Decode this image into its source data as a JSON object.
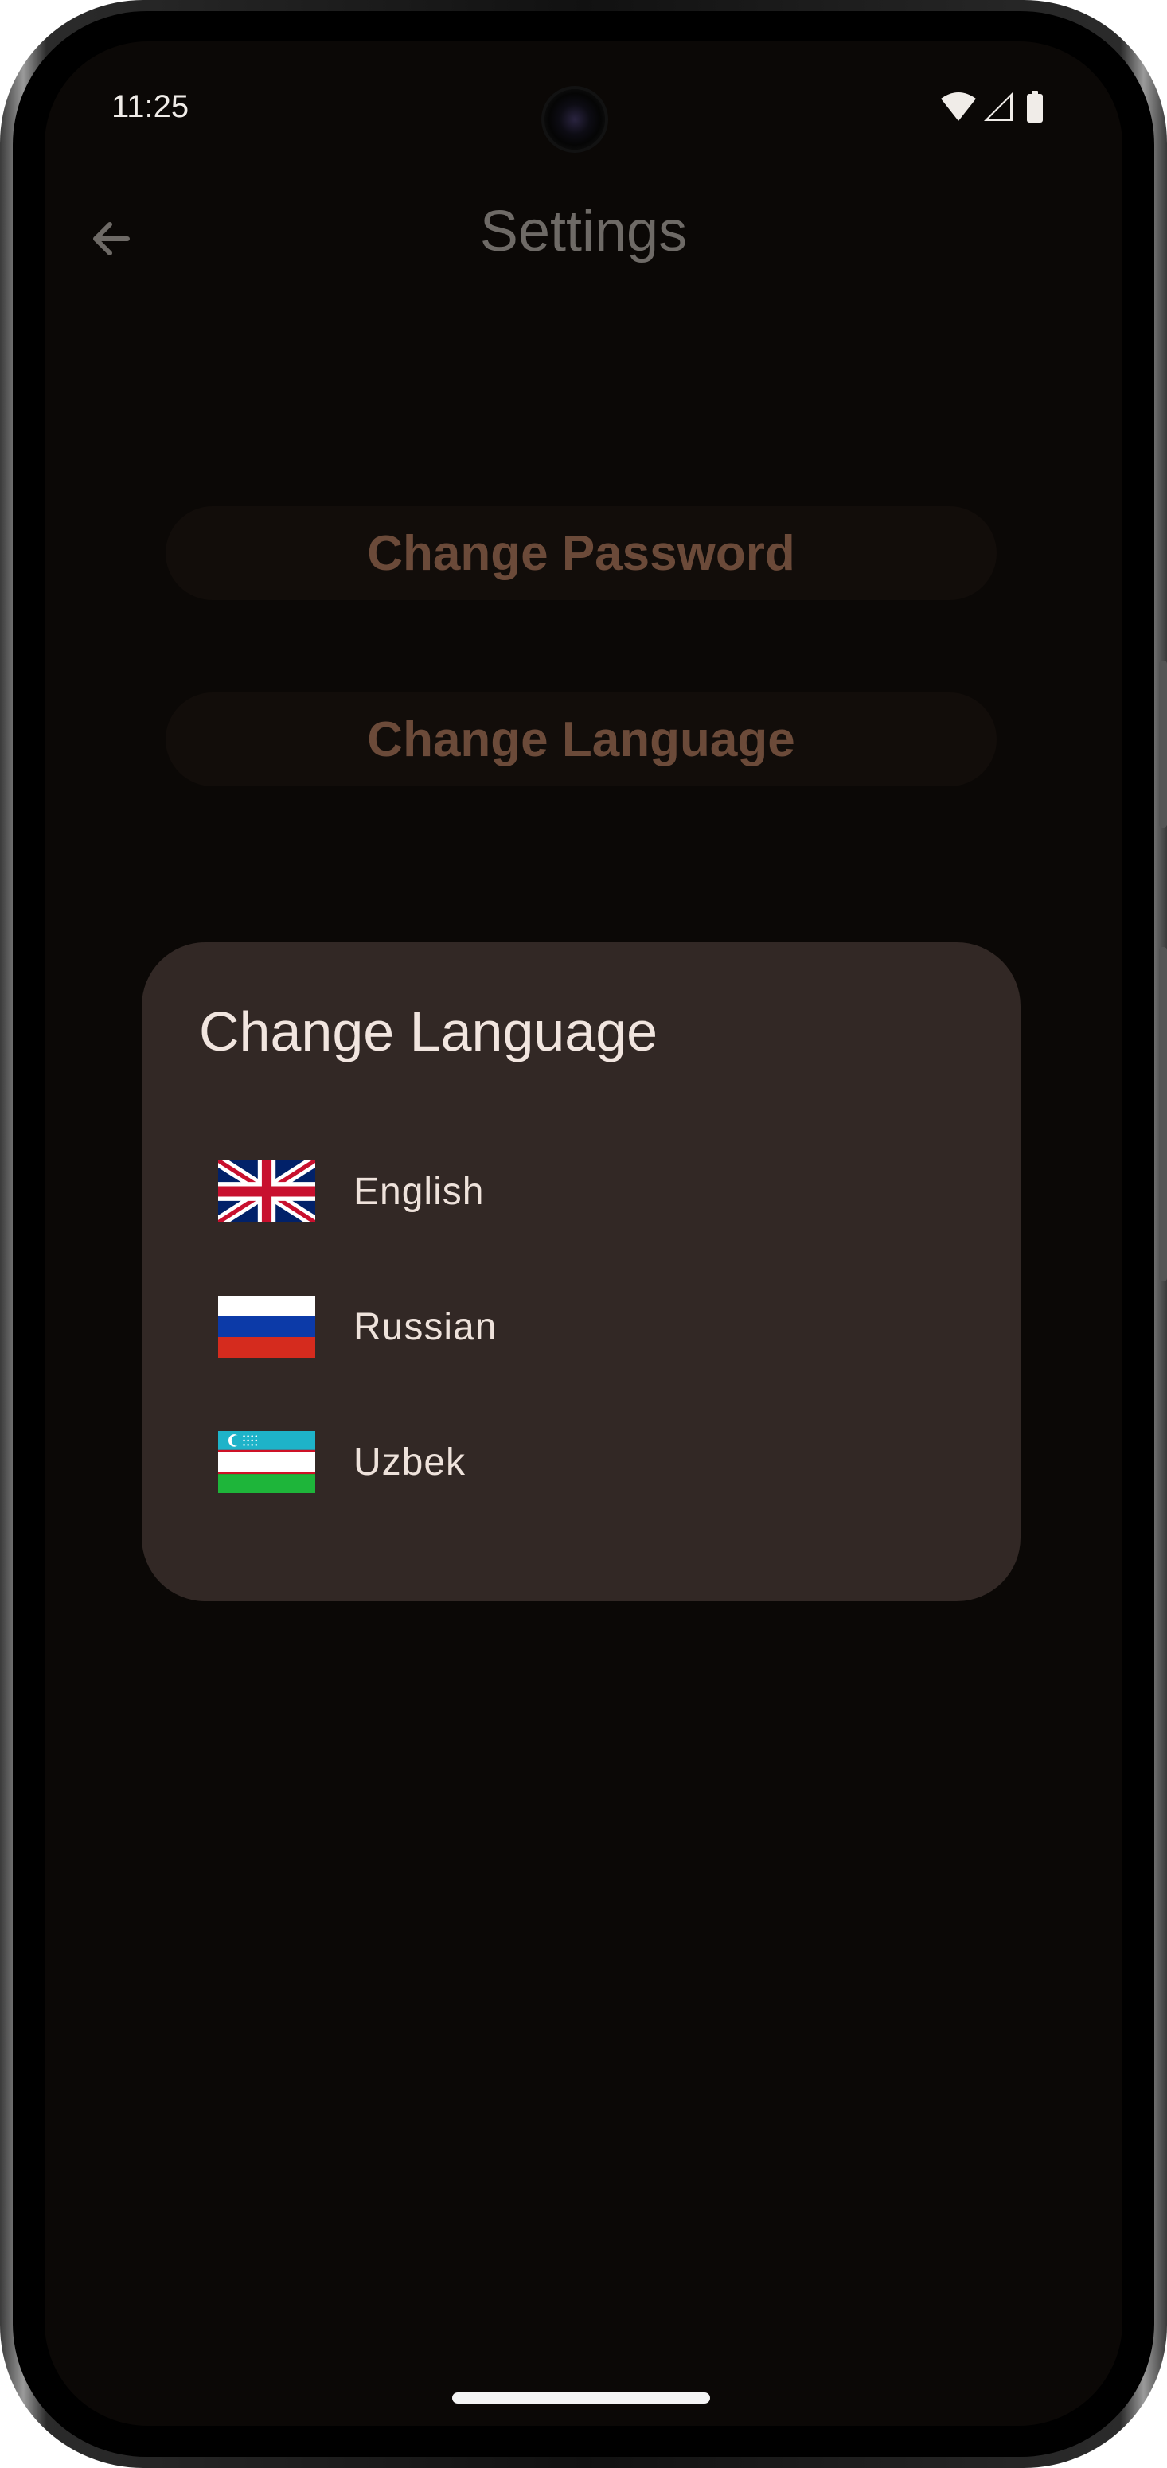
{
  "status_bar": {
    "time": "11:25",
    "icons": [
      "wifi-icon",
      "cellular-signal-icon",
      "battery-icon"
    ]
  },
  "app_bar": {
    "title": "Settings",
    "back_icon": "arrow-back-icon"
  },
  "settings": {
    "change_password_label": "Change Password",
    "change_language_label": "Change Language"
  },
  "dialog": {
    "title": "Change Language",
    "languages": [
      {
        "label": "English",
        "flag": "uk-flag-icon"
      },
      {
        "label": "Russian",
        "flag": "russia-flag-icon"
      },
      {
        "label": "Uzbek",
        "flag": "uzbekistan-flag-icon"
      }
    ]
  },
  "colors": {
    "screen_bg": "#0b0806",
    "dialog_bg": "#322825",
    "button_text": "#6b4a39",
    "title_dim": "#6e6a66"
  }
}
